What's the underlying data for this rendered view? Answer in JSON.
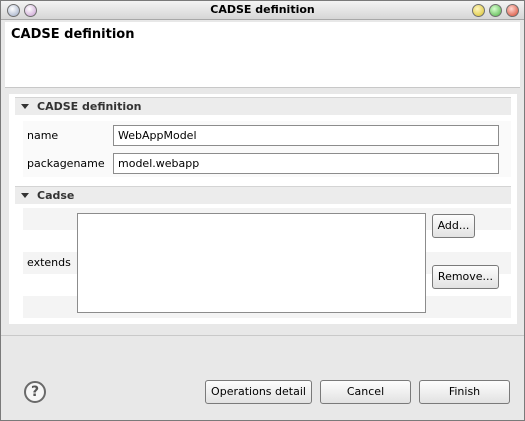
{
  "window": {
    "title": "CADSE definition"
  },
  "header": {
    "title": "CADSE definition"
  },
  "section_definition": {
    "title": "CADSE definition",
    "name_label": "name",
    "name_value": "WebAppModel",
    "package_label": "packagename",
    "package_value": "model.webapp"
  },
  "section_cadse": {
    "title": "Cadse",
    "extends_label": "extends",
    "add_label": "Add...",
    "remove_label": "Remove..."
  },
  "footer": {
    "help_symbol": "?",
    "operations_label": "Operations detail",
    "cancel_label": "Cancel",
    "finish_label": "Finish"
  },
  "icons": {
    "help": "help-icon",
    "collapse": "triangle-down-icon"
  }
}
